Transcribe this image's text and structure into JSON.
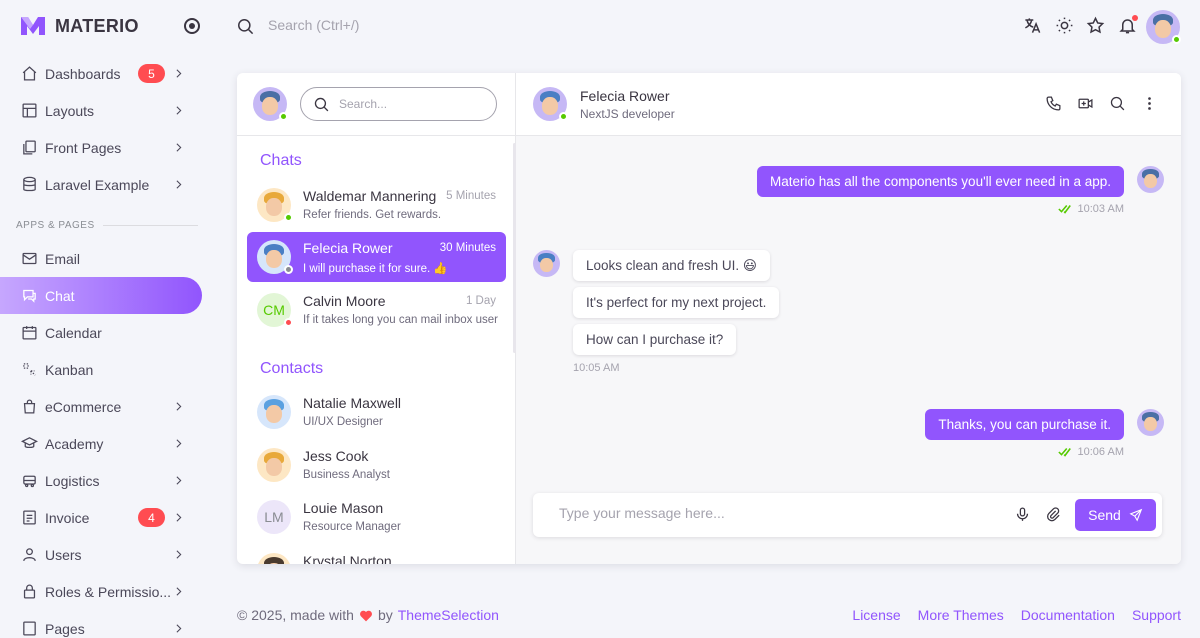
{
  "brand": {
    "name": "MATERIO"
  },
  "colors": {
    "primary": "#9155fd",
    "danger": "#ff4c51",
    "success": "#56ca00"
  },
  "sidebar": {
    "items": [
      {
        "label": "Dashboards",
        "icon": "home-icon",
        "badge": "5",
        "chevron": true
      },
      {
        "label": "Layouts",
        "icon": "layout-icon",
        "chevron": true
      },
      {
        "label": "Front Pages",
        "icon": "pages-icon",
        "chevron": true
      },
      {
        "label": "Laravel Example",
        "icon": "database-icon",
        "chevron": true
      }
    ],
    "section": "APPS & PAGES",
    "apps": [
      {
        "label": "Email",
        "icon": "mail-icon"
      },
      {
        "label": "Chat",
        "icon": "chat-icon",
        "active": true
      },
      {
        "label": "Calendar",
        "icon": "calendar-icon"
      },
      {
        "label": "Kanban",
        "icon": "kanban-icon"
      },
      {
        "label": "eCommerce",
        "icon": "cart-icon",
        "chevron": true
      },
      {
        "label": "Academy",
        "icon": "graduation-icon",
        "chevron": true
      },
      {
        "label": "Logistics",
        "icon": "truck-icon",
        "chevron": true
      },
      {
        "label": "Invoice",
        "icon": "invoice-icon",
        "badge": "4",
        "chevron": true
      },
      {
        "label": "Users",
        "icon": "user-icon",
        "chevron": true
      },
      {
        "label": "Roles & Permissio...",
        "icon": "lock-icon",
        "chevron": true
      },
      {
        "label": "Pages",
        "icon": "page-icon",
        "chevron": true
      }
    ]
  },
  "topbar": {
    "search_placeholder": "Search (Ctrl+/)"
  },
  "chat": {
    "search_placeholder": "Search...",
    "chats_title": "Chats",
    "contacts_title": "Contacts",
    "chats": [
      {
        "name": "Waldemar Mannering",
        "message": "Refer friends. Get rewards.",
        "time": "5 Minutes",
        "status": "online"
      },
      {
        "name": "Felecia Rower",
        "message": "I will purchase it for sure. 👍",
        "time": "30 Minutes",
        "status": "away",
        "active": true
      },
      {
        "name": "Calvin Moore",
        "message": "If it takes long you can mail inbox user",
        "time": "1 Day",
        "status": "busy",
        "initials": "CM"
      }
    ],
    "contacts": [
      {
        "name": "Natalie Maxwell",
        "role": "UI/UX Designer"
      },
      {
        "name": "Jess Cook",
        "role": "Business Analyst"
      },
      {
        "name": "Louie Mason",
        "role": "Resource Manager",
        "initials": "LM"
      },
      {
        "name": "Krystal Norton",
        "role": ""
      }
    ],
    "active_contact": {
      "name": "Felecia Rower",
      "role": "NextJS developer"
    },
    "messages": {
      "m1": "Materio has all the components you'll ever need in a app.",
      "m1_time": "10:03 AM",
      "in1": "Looks clean and fresh UI. 😃",
      "in2": "It's perfect for my next project.",
      "in3": "How can I purchase it?",
      "in_time": "10:05 AM",
      "m2": "Thanks, you can purchase it.",
      "m2_time": "10:06 AM"
    },
    "composer_placeholder": "Type your message here...",
    "send_label": "Send"
  },
  "footer": {
    "copyright": "© 2025, made with",
    "by": "by",
    "company": "ThemeSelection",
    "links": [
      "License",
      "More Themes",
      "Documentation",
      "Support"
    ]
  }
}
